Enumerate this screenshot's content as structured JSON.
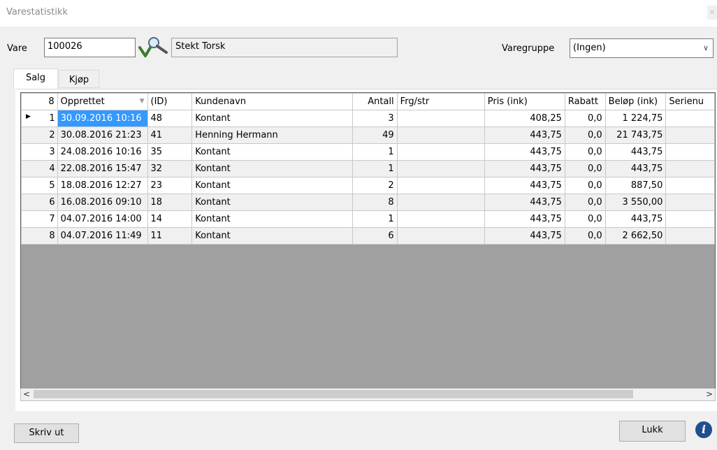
{
  "window": {
    "title": "Varestatistikk",
    "close_glyph": "✕"
  },
  "form": {
    "vare_label": "Vare",
    "vare_value": "100026",
    "vare_name": "Stekt Torsk",
    "varegruppe_label": "Varegruppe",
    "varegruppe_value": "(Ingen)"
  },
  "tabs": [
    {
      "label": "Salg"
    },
    {
      "label": "Kjøp"
    }
  ],
  "grid": {
    "row_count": "8",
    "columns": [
      "Opprettet",
      "(ID)",
      "Kundenavn",
      "Antall",
      "Frg/str",
      "Pris (ink)",
      "Rabatt",
      "Beløp (ink)",
      "Serienu"
    ],
    "rows": [
      {
        "n": "1",
        "opprettet": "30.09.2016 10:16",
        "id": "48",
        "kundenavn": "Kontant",
        "antall": "3",
        "frg": "",
        "pris": "408,25",
        "rabatt": "0,0",
        "belop": "1 224,75",
        "serie": ""
      },
      {
        "n": "2",
        "opprettet": "30.08.2016 21:23",
        "id": "41",
        "kundenavn": "Henning Hermann",
        "antall": "49",
        "frg": "",
        "pris": "443,75",
        "rabatt": "0,0",
        "belop": "21 743,75",
        "serie": ""
      },
      {
        "n": "3",
        "opprettet": "24.08.2016 10:16",
        "id": "35",
        "kundenavn": "Kontant",
        "antall": "1",
        "frg": "",
        "pris": "443,75",
        "rabatt": "0,0",
        "belop": "443,75",
        "serie": ""
      },
      {
        "n": "4",
        "opprettet": "22.08.2016 15:47",
        "id": "32",
        "kundenavn": "Kontant",
        "antall": "1",
        "frg": "",
        "pris": "443,75",
        "rabatt": "0,0",
        "belop": "443,75",
        "serie": ""
      },
      {
        "n": "5",
        "opprettet": "18.08.2016 12:27",
        "id": "23",
        "kundenavn": "Kontant",
        "antall": "2",
        "frg": "",
        "pris": "443,75",
        "rabatt": "0,0",
        "belop": "887,50",
        "serie": ""
      },
      {
        "n": "6",
        "opprettet": "16.08.2016 09:10",
        "id": "18",
        "kundenavn": "Kontant",
        "antall": "8",
        "frg": "",
        "pris": "443,75",
        "rabatt": "0,0",
        "belop": "3 550,00",
        "serie": ""
      },
      {
        "n": "7",
        "opprettet": "04.07.2016 14:00",
        "id": "14",
        "kundenavn": "Kontant",
        "antall": "1",
        "frg": "",
        "pris": "443,75",
        "rabatt": "0,0",
        "belop": "443,75",
        "serie": ""
      },
      {
        "n": "8",
        "opprettet": "04.07.2016 11:49",
        "id": "11",
        "kundenavn": "Kontant",
        "antall": "6",
        "frg": "",
        "pris": "443,75",
        "rabatt": "0,0",
        "belop": "2 662,50",
        "serie": ""
      }
    ]
  },
  "icons": {
    "search": "magnifier-check-icon",
    "info": "info-icon",
    "info_glyph": "i"
  },
  "buttons": {
    "print": "Skriv ut",
    "close": "Lukk"
  },
  "colors": {
    "selection": "#3399ff",
    "info_icon": "#1f4f8f"
  }
}
